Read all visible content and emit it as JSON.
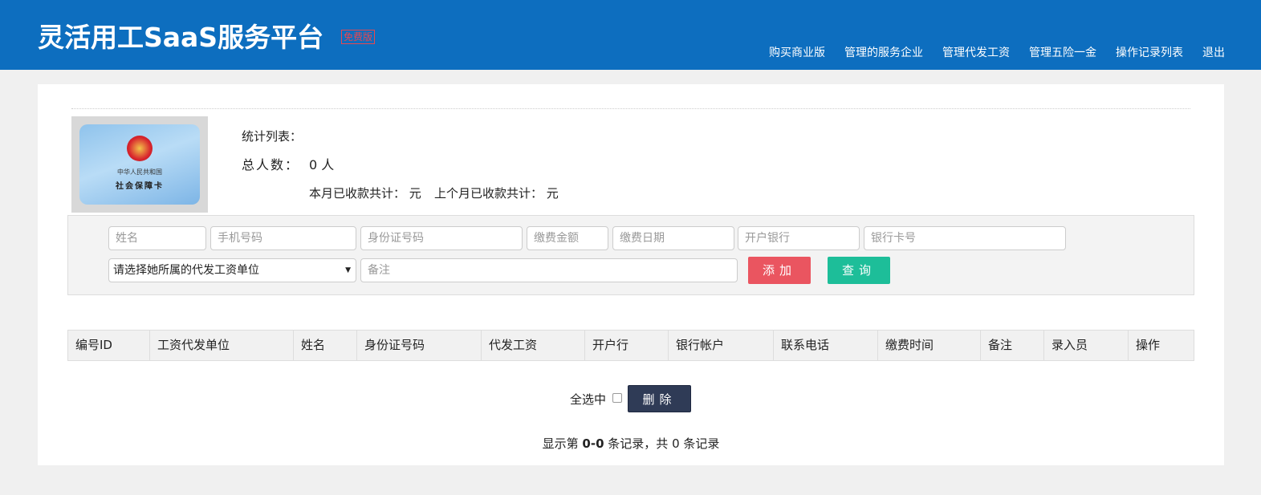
{
  "header": {
    "brand": "灵活用工SaaS服务平台",
    "badge": "免费版",
    "nav": [
      "购买商业版",
      "管理的服务企业",
      "管理代发工资",
      "管理五险一金",
      "操作记录列表",
      "退出"
    ]
  },
  "card": {
    "caption_top": "中华人民共和国",
    "caption_bottom": "社会保障卡"
  },
  "stats": {
    "list_label": "统计列表：",
    "total_label": "总人数：",
    "total_value": "0 人",
    "monthly": "本月已收款共计： 元",
    "last_month": "上个月已收款共计： 元"
  },
  "form": {
    "placeholders": {
      "name": "姓名",
      "phone": "手机号码",
      "idcard": "身份证号码",
      "amount": "缴费金额",
      "date": "缴费日期",
      "bank": "开户银行",
      "cardno": "银行卡号",
      "remark": "备注"
    },
    "select_value": "请选择她所属的代发工资单位",
    "add_label": "添加",
    "query_label": "查询"
  },
  "table": {
    "headers": [
      "编号ID",
      "工资代发单位",
      "姓名",
      "身份证号码",
      "代发工资",
      "开户行",
      "银行帐户",
      "联系电话",
      "缴费时间",
      "备注",
      "录入员",
      "操作"
    ]
  },
  "bulk": {
    "select_all_label": "全选中",
    "delete_label": "删除"
  },
  "pagination": {
    "prefix": "显示第",
    "range": "0-0",
    "suffix": "条记录，共 0 条记录"
  },
  "colors": {
    "header_bg": "#0d6ebf",
    "add_button": "#ea5560",
    "query_button": "#1dbe99",
    "delete_button": "#2f3b56"
  }
}
